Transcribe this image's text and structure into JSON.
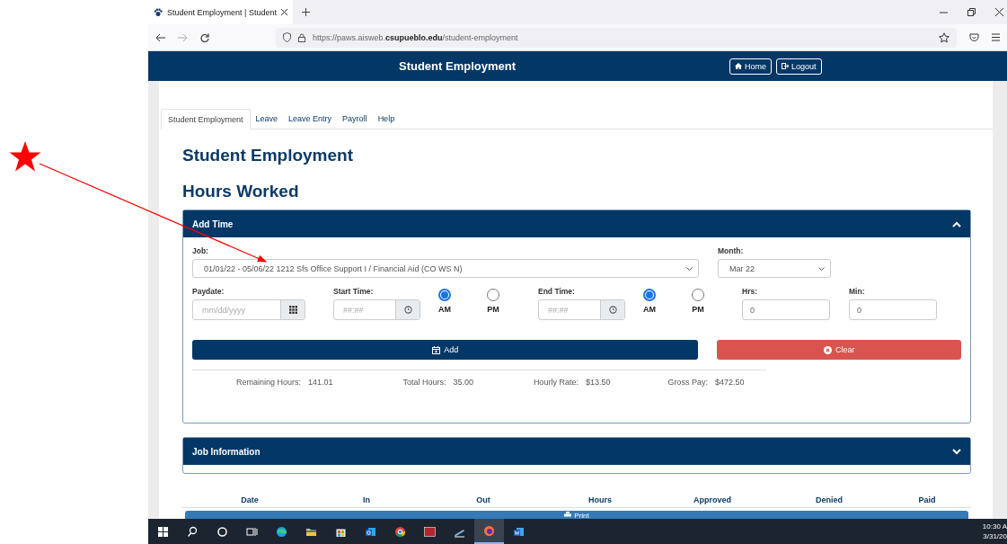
{
  "browser": {
    "tab_title": "Student Employment | Student",
    "url": "https://paws.aisweb.**csupueblo.edu**/student-employment"
  },
  "header": {
    "title": "Student Employment",
    "buttons": [
      "Home",
      "Logout"
    ]
  },
  "tabs": [
    {
      "label": "Student Employment",
      "selected": true
    },
    {
      "label": "Leave",
      "selected": false
    },
    {
      "label": "Leave Entry",
      "selected": false
    },
    {
      "label": "Payroll",
      "selected": false
    },
    {
      "label": "Help",
      "selected": false
    }
  ],
  "page_title": "Student Employment",
  "section_title": "Hours Worked",
  "add_time": {
    "title": "Add Time",
    "expanded": true,
    "job": {
      "label": "Job:",
      "value": "01/01/22 - 05/06/22 1212  Sfs Office Support I / Financial Aid (CO WS N)"
    },
    "month": {
      "label": "Month:",
      "value": "Mar 22"
    },
    "paydate": {
      "label": "Paydate:",
      "placeholder": "mm/dd/yyyy"
    },
    "start_time": {
      "label": "Start Time:",
      "placeholder": "##:##",
      "periods": [
        {
          "label": "AM",
          "selected": true
        },
        {
          "label": "PM",
          "selected": false
        }
      ]
    },
    "end_time": {
      "label": "End Time:",
      "placeholder": "##:##",
      "periods": [
        {
          "label": "AM",
          "selected": true
        },
        {
          "label": "PM",
          "selected": false
        }
      ]
    },
    "hrs": {
      "label": "Hrs:",
      "value": "0"
    },
    "min": {
      "label": "Min:",
      "value": "0"
    },
    "add_button": "Add",
    "clear_button": "Clear",
    "summary": [
      {
        "label": "Remaining Hours:",
        "value": "141.01"
      },
      {
        "label": "Total Hours:",
        "value": "35.00"
      },
      {
        "label": "Hourly Rate:",
        "value": "$13.50"
      },
      {
        "label": "Gross Pay:",
        "value": "$472.50"
      }
    ]
  },
  "job_information": {
    "title": "Job Information",
    "expanded": false
  },
  "table": {
    "columns": [
      "Date",
      "In",
      "Out",
      "Hours",
      "Approved",
      "Denied",
      "Paid"
    ]
  },
  "print_button": "Print",
  "taskbar": {
    "clock": [
      "10:30 A",
      "3/31/20"
    ]
  }
}
